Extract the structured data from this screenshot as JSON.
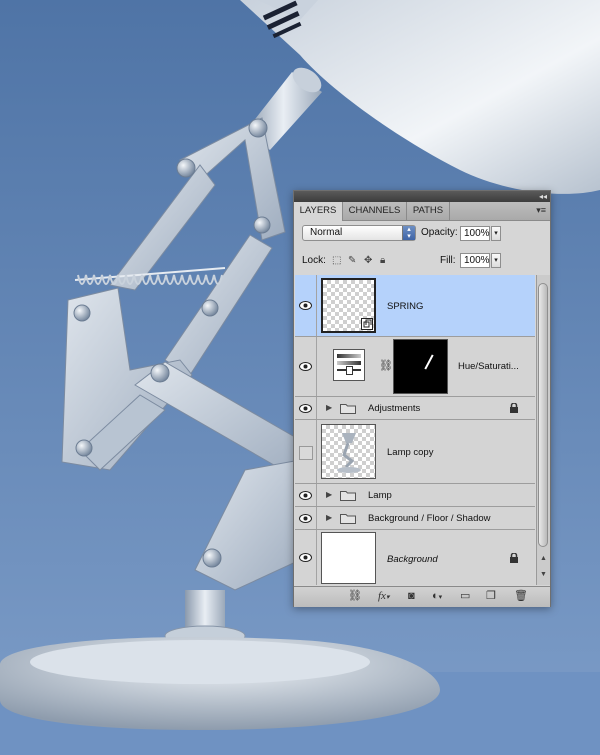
{
  "panel": {
    "tabs": [
      "LAYERS",
      "CHANNELS",
      "PATHS"
    ],
    "collapse_icon": "double-arrow-icon",
    "menu_icon": "panel-menu-icon",
    "blend_mode": "Normal",
    "opacity_label": "Opacity:",
    "opacity_value": "100%",
    "lock_label": "Lock:",
    "fill_label": "Fill:",
    "fill_value": "100%"
  },
  "layers": [
    {
      "name": "SPRING",
      "type": "smart-object",
      "visible": true,
      "selected": true
    },
    {
      "name": "Hue/Saturati...",
      "type": "adjustment-with-mask",
      "visible": true
    },
    {
      "name": "Adjustments",
      "type": "group",
      "visible": true,
      "locked": true
    },
    {
      "name": "Lamp copy",
      "type": "pixel",
      "visible": false
    },
    {
      "name": "Lamp",
      "type": "group",
      "visible": true
    },
    {
      "name": "Background / Floor / Shadow",
      "type": "group",
      "visible": true
    },
    {
      "name": "Background",
      "type": "background",
      "visible": true,
      "locked": true
    }
  ],
  "colors": {
    "selection": "#b5d2fb",
    "sky_top": "#4f74a6",
    "sky_bottom": "#7d9dc8"
  }
}
